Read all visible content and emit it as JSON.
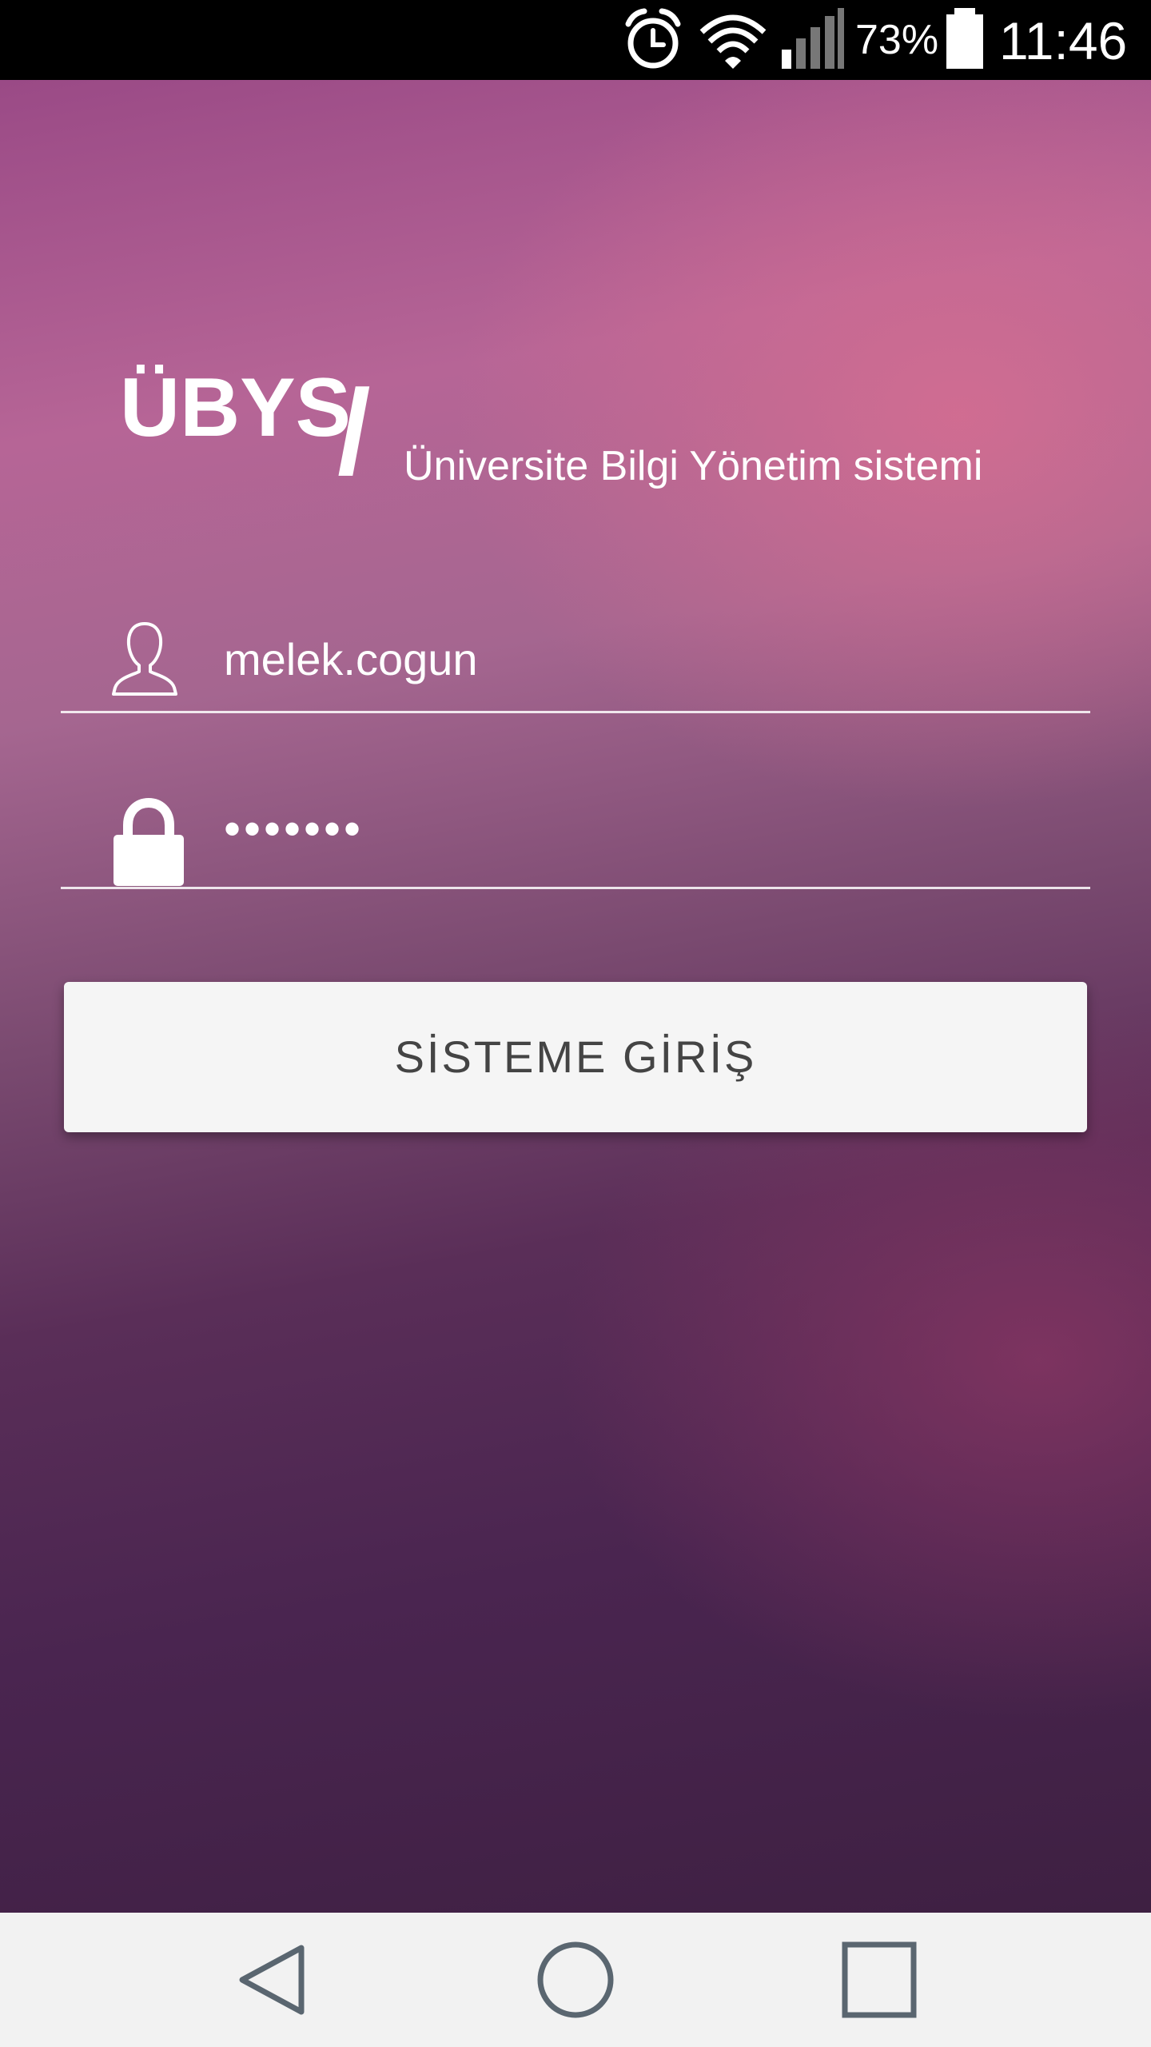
{
  "status_bar": {
    "battery_percent": "73%",
    "time": "11:46",
    "icons": [
      "alarm-icon",
      "wifi-icon",
      "signal-icon",
      "battery-icon"
    ]
  },
  "header": {
    "logo_title": "ÜBYS",
    "slash": "/",
    "subtitle": "Üniversite Bilgi Yönetim sistemi"
  },
  "form": {
    "username": {
      "value": "melek.cogun",
      "icon": "user-icon"
    },
    "password": {
      "value": "•••••••",
      "icon": "lock-icon"
    },
    "login_label": "SİSTEME GİRİŞ"
  },
  "nav_bar": {
    "icons": [
      "back-icon",
      "home-icon",
      "recents-icon"
    ]
  },
  "colors": {
    "status_bar_bg": "#000000",
    "nav_bar_bg": "#f2f2f2",
    "button_bg": "#f5f5f5",
    "button_text": "#444444",
    "bg_top": "#b66596",
    "bg_bottom": "#3e2042"
  }
}
